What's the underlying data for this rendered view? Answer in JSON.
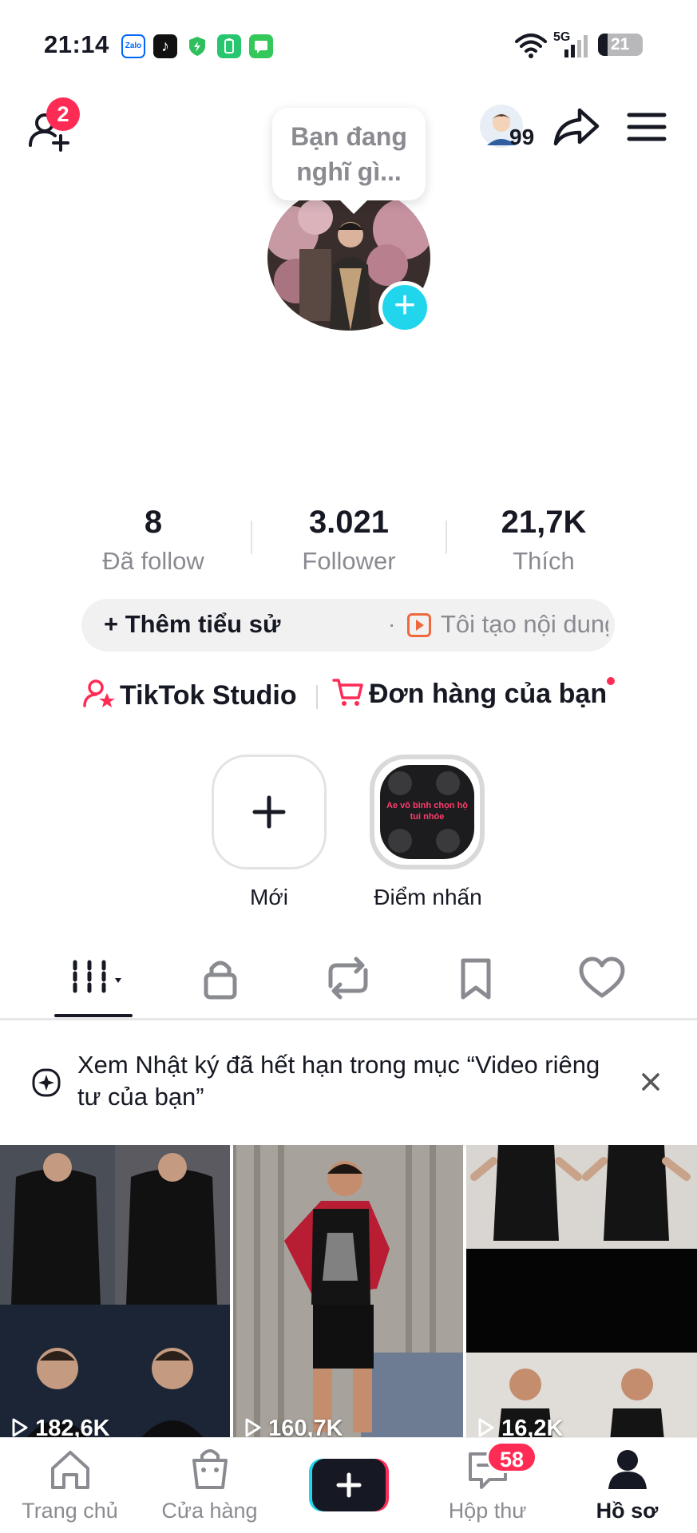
{
  "status_bar": {
    "time": "21:14",
    "network": "5G",
    "battery": "21"
  },
  "header": {
    "follow_badge_count": "2",
    "avatar_badge": "99",
    "bubble_line1": "Bạn đang",
    "bubble_line2": "nghĩ gì..."
  },
  "stats": [
    {
      "value": "8",
      "label": "Đã follow"
    },
    {
      "value": "3.021",
      "label": "Follower"
    },
    {
      "value": "21,7K",
      "label": "Thích"
    }
  ],
  "bio": {
    "add_label": "+ Thêm tiểu sử",
    "separator": "·",
    "description": "Tôi tạo nội dung v..."
  },
  "links": {
    "studio": "TikTok Studio",
    "orders": "Đơn hàng của bạn"
  },
  "highlights": {
    "new_label": "Mới",
    "featured_label": "Điểm nhấn",
    "featured_caption": "Ae vô bình chọn hộ tui nhóe"
  },
  "notice": {
    "text": "Xem Nhật ký đã hết hạn trong mục “Video riêng tư của bạn”"
  },
  "videos": [
    {
      "views": "182,6K"
    },
    {
      "views": "160,7K"
    },
    {
      "views": "16,2K"
    }
  ],
  "bottom_nav": {
    "home": "Trang chủ",
    "shop": "Cửa hàng",
    "inbox": "Hộp thư",
    "inbox_badge": "58",
    "profile": "Hồ sơ"
  },
  "colors": {
    "accent_red": "#fe2c55",
    "accent_cyan": "#20d5ec",
    "text_primary": "#161823",
    "text_secondary": "#8a8b91"
  }
}
